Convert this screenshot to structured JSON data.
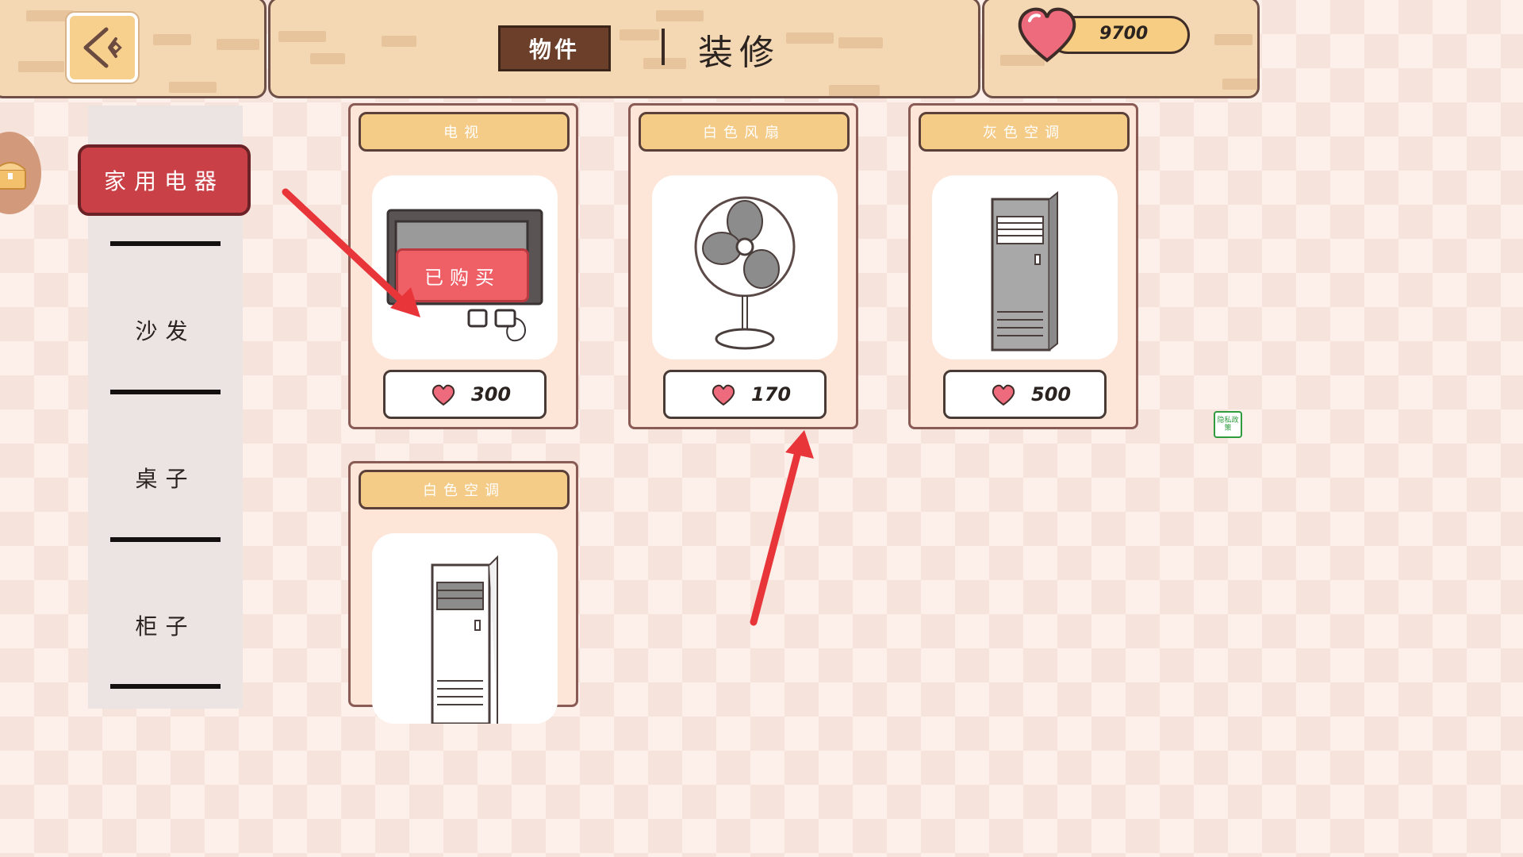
{
  "header": {
    "tab_items_label": "物件",
    "tab_decorate_label": "装修",
    "currency_value": "9700"
  },
  "categories": [
    {
      "label": "家用电器",
      "selected": true
    },
    {
      "label": "沙发",
      "selected": false
    },
    {
      "label": "桌子",
      "selected": false
    },
    {
      "label": "柜子",
      "selected": false
    }
  ],
  "items": [
    {
      "name": "电视",
      "price": "300",
      "purchased": true,
      "purchased_label": "已购买",
      "icon": "tv-icon"
    },
    {
      "name": "白色风扇",
      "price": "170",
      "purchased": false,
      "icon": "fan-icon"
    },
    {
      "name": "灰色空调",
      "price": "500",
      "purchased": false,
      "icon": "gray-ac-icon"
    },
    {
      "name": "白色空调",
      "price": "",
      "purchased": false,
      "icon": "white-ac-icon"
    }
  ],
  "privacy_label": "隐私政策",
  "colors": {
    "accent_red": "#c94047",
    "purchased_red": "#ee5f66",
    "card_bg": "#fde6d8",
    "title_bar": "#f4cb87",
    "tab_wood": "#6b3f2a",
    "annotation_arrow": "#e8353a"
  }
}
